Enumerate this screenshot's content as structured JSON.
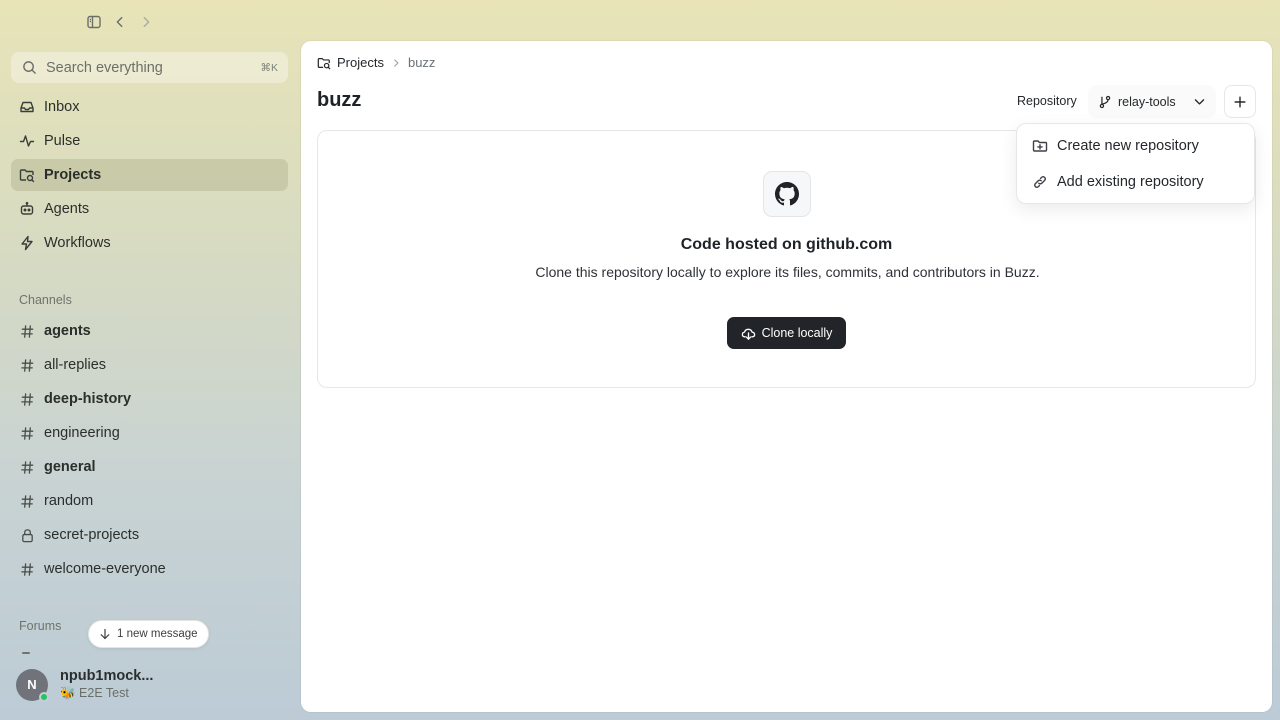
{
  "sidebar": {
    "search": {
      "placeholder": "Search everything",
      "shortcut": "⌘K"
    },
    "nav": [
      {
        "label": "Inbox",
        "icon": "inbox-icon"
      },
      {
        "label": "Pulse",
        "icon": "pulse-icon"
      },
      {
        "label": "Projects",
        "icon": "folder-icon",
        "active": true
      },
      {
        "label": "Agents",
        "icon": "bot-icon"
      },
      {
        "label": "Workflows",
        "icon": "bolt-icon"
      }
    ],
    "channels_label": "Channels",
    "channels": [
      {
        "label": "agents",
        "icon": "hash-icon",
        "unread": true
      },
      {
        "label": "all-replies",
        "icon": "hash-icon",
        "unread": false
      },
      {
        "label": "deep-history",
        "icon": "hash-icon",
        "unread": true
      },
      {
        "label": "engineering",
        "icon": "hash-icon",
        "unread": false
      },
      {
        "label": "general",
        "icon": "hash-icon",
        "unread": true
      },
      {
        "label": "random",
        "icon": "hash-icon",
        "unread": false
      },
      {
        "label": "secret-projects",
        "icon": "lock-icon",
        "unread": false
      },
      {
        "label": "welcome-everyone",
        "icon": "hash-icon",
        "unread": false
      }
    ],
    "forums_label": "Forums",
    "new_message_pill": "1 new message",
    "user": {
      "initial": "N",
      "name": "npub1mock...",
      "status": "🐝 E2E Test",
      "online": true
    }
  },
  "main": {
    "breadcrumb": {
      "root": "Projects",
      "current": "buzz"
    },
    "title": "buzz",
    "repository_label": "Repository",
    "repository_selected": "relay-tools",
    "empty_state": {
      "icon": "github-icon",
      "title": "Code hosted on github.com",
      "description": "Clone this repository locally to explore its files, commits, and contributors in Buzz.",
      "button": "Clone locally"
    }
  },
  "dropdown": {
    "items": [
      {
        "label": "Create new repository",
        "icon": "folder-plus-icon"
      },
      {
        "label": "Add existing repository",
        "icon": "link-icon"
      }
    ]
  },
  "colors": {
    "accent_dark": "#212529",
    "online": "#22c55e",
    "sidebar_active": "#c9c8a6"
  }
}
